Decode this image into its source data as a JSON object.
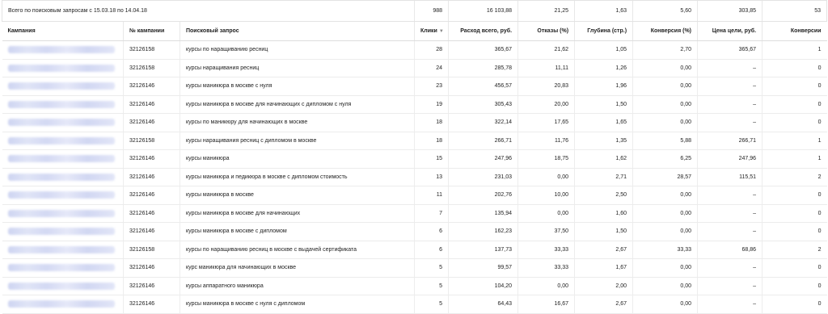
{
  "summary": {
    "label": "Всего по поисковым запросам с 15.03.18 по 14.04.18",
    "clicks": "988",
    "spend": "16 103,88",
    "bounces": "21,25",
    "depth": "1,63",
    "conversion": "5,60",
    "goal_price": "303,85",
    "conversions": "53"
  },
  "columns": {
    "campaign": "Кампания",
    "campaign_id": "№ кампании",
    "query": "Поисковый запрос",
    "clicks": "Клики",
    "spend": "Расход всего, руб.",
    "bounces": "Отказы (%)",
    "depth": "Глубина (стр.)",
    "conversion": "Конверсия (%)",
    "goal_price": "Цена цели, руб.",
    "conversions": "Конверсии"
  },
  "sort_icon": "triangle-down-icon",
  "rows": [
    {
      "id": "32126158",
      "query": "курсы по наращиванию ресниц",
      "clicks": "28",
      "spend": "365,67",
      "bounces": "21,62",
      "depth": "1,05",
      "conversion": "2,70",
      "goal_price": "365,67",
      "conversions": "1"
    },
    {
      "id": "32126158",
      "query": "курсы наращивания ресниц",
      "clicks": "24",
      "spend": "285,78",
      "bounces": "11,11",
      "depth": "1,26",
      "conversion": "0,00",
      "goal_price": "–",
      "conversions": "0"
    },
    {
      "id": "32126146",
      "query": "курсы маникюра в москве с нуля",
      "clicks": "23",
      "spend": "456,57",
      "bounces": "20,83",
      "depth": "1,96",
      "conversion": "0,00",
      "goal_price": "–",
      "conversions": "0"
    },
    {
      "id": "32126146",
      "query": "курсы маникюра в москве для начинающих с дипломом с нуля",
      "clicks": "19",
      "spend": "305,43",
      "bounces": "20,00",
      "depth": "1,50",
      "conversion": "0,00",
      "goal_price": "–",
      "conversions": "0"
    },
    {
      "id": "32126146",
      "query": "курсы по маникюру для начинающих в москве",
      "clicks": "18",
      "spend": "322,14",
      "bounces": "17,65",
      "depth": "1,65",
      "conversion": "0,00",
      "goal_price": "–",
      "conversions": "0"
    },
    {
      "id": "32126158",
      "query": "курсы наращивания ресниц с дипломом в москве",
      "clicks": "18",
      "spend": "266,71",
      "bounces": "11,76",
      "depth": "1,35",
      "conversion": "5,88",
      "goal_price": "266,71",
      "conversions": "1"
    },
    {
      "id": "32126146",
      "query": "курсы маникюра",
      "clicks": "15",
      "spend": "247,96",
      "bounces": "18,75",
      "depth": "1,62",
      "conversion": "6,25",
      "goal_price": "247,96",
      "conversions": "1"
    },
    {
      "id": "32126146",
      "query": "курсы маникюра и педикюра в москве с дипломом стоимость",
      "clicks": "13",
      "spend": "231,03",
      "bounces": "0,00",
      "depth": "2,71",
      "conversion": "28,57",
      "goal_price": "115,51",
      "conversions": "2"
    },
    {
      "id": "32126146",
      "query": "курсы маникюра в москве",
      "clicks": "11",
      "spend": "202,76",
      "bounces": "10,00",
      "depth": "2,50",
      "conversion": "0,00",
      "goal_price": "–",
      "conversions": "0"
    },
    {
      "id": "32126146",
      "query": "курсы маникюра в москве для начинающих",
      "clicks": "7",
      "spend": "135,94",
      "bounces": "0,00",
      "depth": "1,60",
      "conversion": "0,00",
      "goal_price": "–",
      "conversions": "0"
    },
    {
      "id": "32126146",
      "query": "курсы маникюра в москве с дипломом",
      "clicks": "6",
      "spend": "162,23",
      "bounces": "37,50",
      "depth": "1,50",
      "conversion": "0,00",
      "goal_price": "–",
      "conversions": "0"
    },
    {
      "id": "32126158",
      "query": "курсы по наращиванию ресниц в москве с выдачей сертификата",
      "clicks": "6",
      "spend": "137,73",
      "bounces": "33,33",
      "depth": "2,67",
      "conversion": "33,33",
      "goal_price": "68,86",
      "conversions": "2"
    },
    {
      "id": "32126146",
      "query": "курс маникюра для начинающих в москве",
      "clicks": "5",
      "spend": "99,57",
      "bounces": "33,33",
      "depth": "1,67",
      "conversion": "0,00",
      "goal_price": "–",
      "conversions": "0"
    },
    {
      "id": "32126146",
      "query": "курсы аппаратного маникюра",
      "clicks": "5",
      "spend": "104,20",
      "bounces": "0,00",
      "depth": "2,00",
      "conversion": "0,00",
      "goal_price": "–",
      "conversions": "0"
    },
    {
      "id": "32126146",
      "query": "курсы маникюра в москве с нуля с дипломом",
      "clicks": "5",
      "spend": "64,43",
      "bounces": "16,67",
      "depth": "2,67",
      "conversion": "0,00",
      "goal_price": "–",
      "conversions": "0"
    }
  ]
}
